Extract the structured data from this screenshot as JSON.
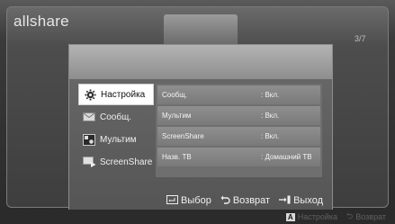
{
  "app": {
    "logo": "allshare",
    "page_count": "3/7"
  },
  "menu": {
    "items": [
      {
        "label": "Настройка",
        "icon": "gear-icon",
        "active": true
      },
      {
        "label": "Сообщ.",
        "icon": "envelope-icon",
        "active": false
      },
      {
        "label": "Мультим",
        "icon": "media-icon",
        "active": false
      },
      {
        "label": "ScreenShare",
        "icon": "screen-share-icon",
        "active": false
      }
    ]
  },
  "settings": {
    "rows": [
      {
        "label": "Сообщ.",
        "value": ": Вкл."
      },
      {
        "label": "Мультим",
        "value": ": Вкл."
      },
      {
        "label": "ScreenShare",
        "value": ": Вкл."
      },
      {
        "label": "Назв. ТВ",
        "value": ": Домашний ТВ"
      }
    ]
  },
  "footer": {
    "select_label": "Выбор",
    "back_label": "Возврат",
    "exit_label": "Выход"
  },
  "bottom_bar": {
    "a_key": "A",
    "settings_label": "Настройка",
    "back_label": "Возврат"
  }
}
